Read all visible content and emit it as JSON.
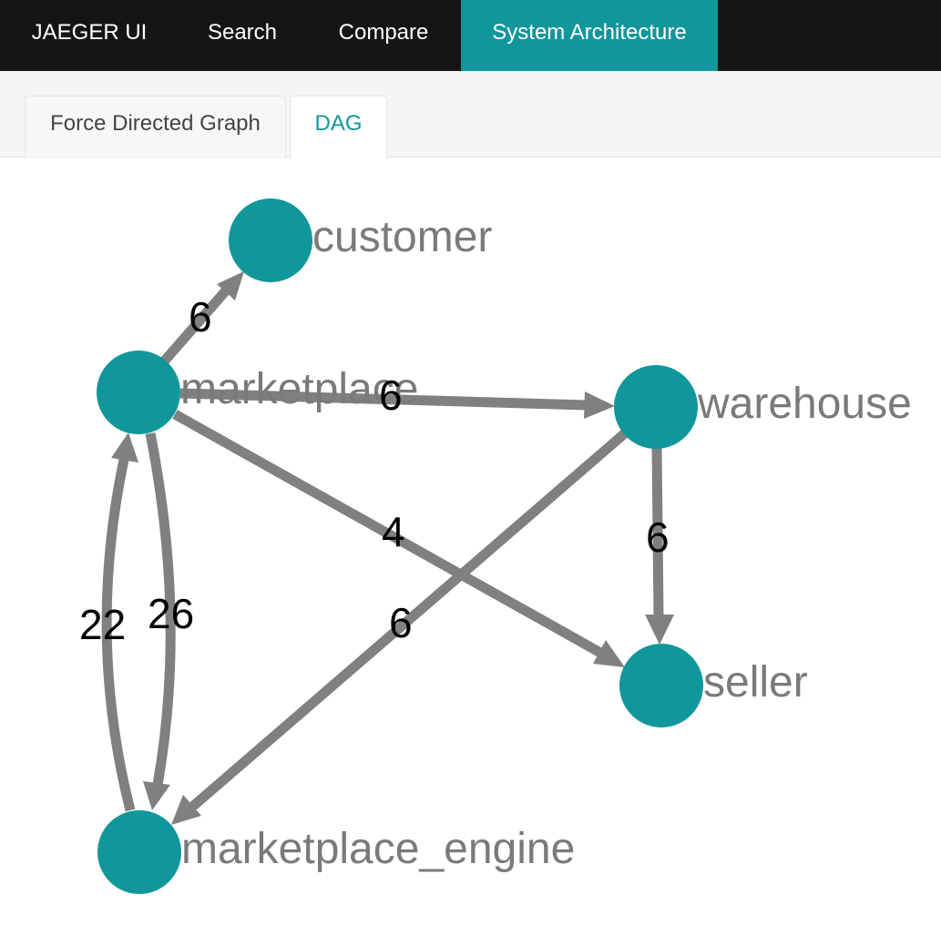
{
  "nav": {
    "brand": "JAEGER UI",
    "search": "Search",
    "compare": "Compare",
    "system_architecture": "System Architecture"
  },
  "tabs": {
    "force_directed": "Force Directed Graph",
    "dag": "DAG",
    "active": "DAG"
  },
  "colors": {
    "nav_background": "#151515",
    "accent": "#11979b",
    "edge": "#808080",
    "node_label": "#7a7a7a"
  },
  "graph": {
    "nodes": {
      "customer": "customer",
      "marketplace": "marketplace",
      "warehouse": "warehouse",
      "seller": "seller",
      "marketplace_engine": "marketplace_engine"
    },
    "edges": {
      "marketplace_customer": "6",
      "marketplace_warehouse": "6",
      "marketplace_seller": "4",
      "warehouse_seller": "6",
      "warehouse_marketplace_engine": "6",
      "marketplace_marketplace_engine": "26",
      "marketplace_engine_marketplace": "22"
    }
  }
}
